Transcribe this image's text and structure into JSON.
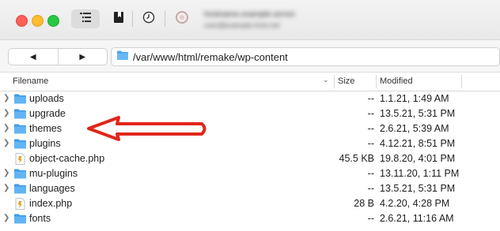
{
  "window": {
    "server_line1": "hostname.example.server",
    "server_line2": "user@example-host.net"
  },
  "toolbar": {
    "back_glyph": "◀",
    "forward_glyph": "▶",
    "path": "/var/www/html/remake/wp-content"
  },
  "columns": {
    "filename": "Filename",
    "size": "Size",
    "modified": "Modified"
  },
  "files": [
    {
      "name": "uploads",
      "type": "folder",
      "size": "--",
      "modified": "1.1.21, 1:49 AM"
    },
    {
      "name": "upgrade",
      "type": "folder",
      "size": "--",
      "modified": "13.5.21, 5:31 PM"
    },
    {
      "name": "themes",
      "type": "folder",
      "size": "--",
      "modified": "2.6.21, 5:39 AM"
    },
    {
      "name": "plugins",
      "type": "folder",
      "size": "--",
      "modified": "4.12.21, 8:51 PM"
    },
    {
      "name": "object-cache.php",
      "type": "php",
      "size": "45.5 KB",
      "modified": "19.8.20, 4:01 PM"
    },
    {
      "name": "mu-plugins",
      "type": "folder",
      "size": "--",
      "modified": "13.11.20, 1:11 PM"
    },
    {
      "name": "languages",
      "type": "folder",
      "size": "--",
      "modified": "13.5.21, 5:31 PM"
    },
    {
      "name": "index.php",
      "type": "php",
      "size": "28 B",
      "modified": "4.2.20, 4:28 PM"
    },
    {
      "name": "fonts",
      "type": "folder",
      "size": "--",
      "modified": "2.6.21, 11:16 AM"
    }
  ],
  "colors": {
    "folder": "#5ab0f2",
    "annotation_arrow": "#e0261b"
  }
}
